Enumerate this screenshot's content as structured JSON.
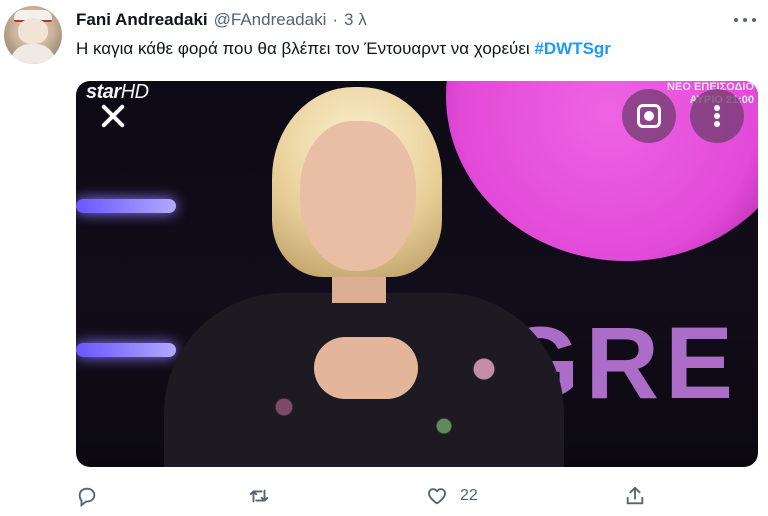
{
  "tweet": {
    "author": {
      "display_name": "Fani Andreadaki",
      "handle": "@FAndreadaki",
      "separator": "·",
      "time": "3 λ"
    },
    "text": "Η καγια κάθε φορά που θα βλέπει τον Έντουαρντ να χορεύει",
    "hashtag": "#DWTSgr",
    "media": {
      "channel_logo_main": "star",
      "channel_logo_suffix": "HD",
      "corner_line1": "ΝΕΟ ΕΠΕΙΣΟΔΙΟ",
      "corner_line2": "ΑΥΡΙΟ 21:00",
      "backdrop_text": "GRE",
      "overlay_buttons": [
        "close-icon",
        "lens-icon",
        "more-vertical-icon"
      ]
    },
    "actions": {
      "reply_count": "",
      "retweet_count": "",
      "like_count": "22",
      "share_count": ""
    },
    "icons": {
      "more": "more-horizontal-icon",
      "reply": "reply-icon",
      "retweet": "retweet-icon",
      "like": "heart-icon",
      "share": "share-icon"
    },
    "colors": {
      "text": "#0f1419",
      "muted": "#536471",
      "link": "#1d9bf0",
      "accent_pink": "#e24ad8"
    }
  }
}
